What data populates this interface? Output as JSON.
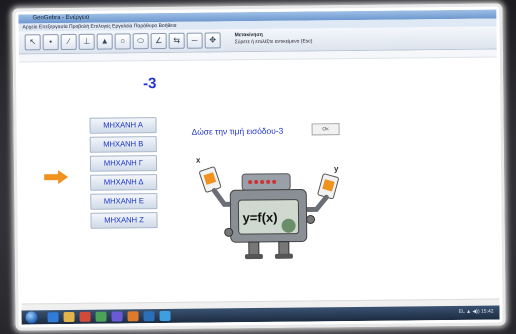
{
  "app": {
    "title": "GeoGebra - Ενέργεια",
    "menu": "Αρχείο  Επεξεργασία  Προβολή  Επιλογές  Εργαλεία  Παράθυρο  Βοήθεια",
    "tool_hint_title": "Μετακίνηση",
    "tool_hint_text": "Σύρετε ή επιλέξτε αντικείμενο (Esc)"
  },
  "toolbar": {
    "icons": [
      "move-icon",
      "point-icon",
      "line-icon",
      "perpendicular-icon",
      "polygon-icon",
      "circle-icon",
      "ellipse-icon",
      "angle-icon",
      "reflect-icon",
      "slider-icon",
      "move-view-icon"
    ]
  },
  "canvas": {
    "current_value": "-3",
    "input_prompt": "Δώσε την τιμή εισόδου-3",
    "input_button": "Οκ",
    "machines": [
      {
        "label": "ΜΗΧΑΝΗ Α"
      },
      {
        "label": "ΜΗΧΑΝΗ Β"
      },
      {
        "label": "ΜΗΧΑΝΗ Γ"
      },
      {
        "label": "ΜΗΧΑΝΗ Δ"
      },
      {
        "label": "ΜΗΧΑΝΗ Ε"
      },
      {
        "label": "ΜΗΧΑΝΗ Ζ"
      }
    ],
    "selected_machine_index": 3,
    "robot": {
      "label": "y=f(x)",
      "input_var": "x",
      "output_var": "y"
    }
  },
  "taskbar": {
    "tray_text": "EL  ▲  ◀))  15:42"
  },
  "colors": {
    "accent_blue": "#1e33d4",
    "arrow_orange": "#f0921e",
    "robot_gray": "#8a8f96"
  }
}
